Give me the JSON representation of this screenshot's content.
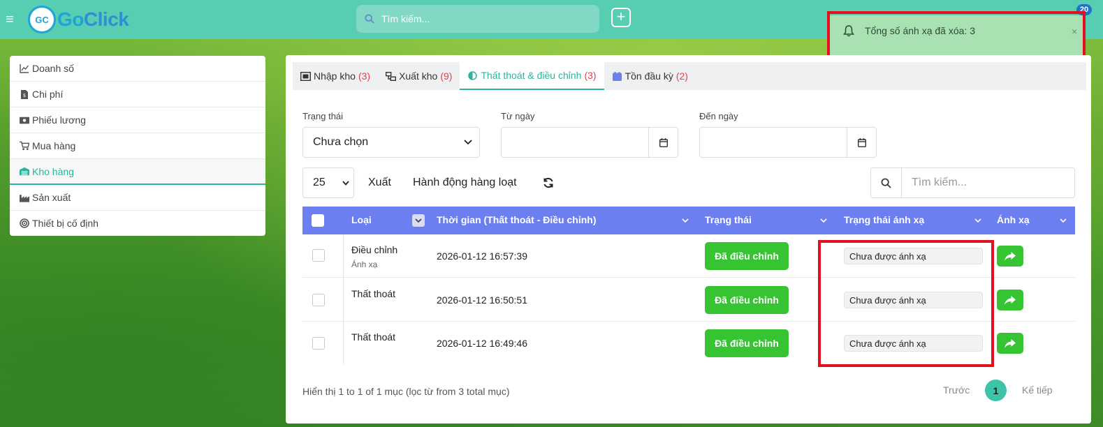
{
  "topbar": {
    "logo_badge": "GC",
    "logo_text_go": "Go",
    "logo_text_click": "Click",
    "search_placeholder": "Tìm kiếm...",
    "notification_count": "20"
  },
  "toast": {
    "message": "Tổng số ánh xạ đã xóa: 3",
    "close": "×"
  },
  "sidebar": {
    "items": [
      {
        "label": "Doanh số",
        "icon": "chart-line-icon"
      },
      {
        "label": "Chi phí",
        "icon": "invoice-icon"
      },
      {
        "label": "Phiếu lương",
        "icon": "money-bill-icon"
      },
      {
        "label": "Mua hàng",
        "icon": "cart-icon"
      },
      {
        "label": "Kho hàng",
        "icon": "warehouse-icon",
        "active": true
      },
      {
        "label": "Sản xuất",
        "icon": "industry-icon"
      },
      {
        "label": "Thiết bị cố định",
        "icon": "target-icon"
      }
    ]
  },
  "tabs": [
    {
      "label": "Nhập kho",
      "count": "(3)"
    },
    {
      "label": "Xuất kho",
      "count": "(9)"
    },
    {
      "label": "Thất thoát & điều chỉnh",
      "count": "(3)",
      "active": true
    },
    {
      "label": "Tồn đầu kỳ",
      "count": "(2)"
    }
  ],
  "filters": {
    "status_label": "Trạng thái",
    "status_value": "Chưa chọn",
    "from_label": "Từ ngày",
    "to_label": "Đến ngày"
  },
  "toolbar": {
    "page_size": "25",
    "export": "Xuất",
    "bulk": "Hành động hàng loạt",
    "search_placeholder": "Tìm kiếm..."
  },
  "table": {
    "headers": {
      "type": "Loại",
      "time": "Thời gian (Thất thoát - Điều chỉnh)",
      "status": "Trạng thái",
      "map_status": "Trạng thái ánh xạ",
      "map": "Ánh xạ"
    },
    "rows": [
      {
        "type": "Điều chỉnh",
        "sub": "Ánh xạ",
        "time": "2026-01-12 16:57:39",
        "status": "Đã điều chỉnh",
        "map_status": "Chưa được ánh xạ"
      },
      {
        "type": "Thất thoát",
        "sub": "",
        "time": "2026-01-12 16:50:51",
        "status": "Đã điều chỉnh",
        "map_status": "Chưa được ánh xạ"
      },
      {
        "type": "Thất thoát",
        "sub": "",
        "time": "2026-01-12 16:49:46",
        "status": "Đã điều chỉnh",
        "map_status": "Chưa được ánh xạ"
      }
    ]
  },
  "footer": {
    "info": "Hiển thị 1 to 1 of 1 mục (lọc từ from 3 total mục)",
    "prev": "Trước",
    "current": "1",
    "next": "Kế tiếp"
  },
  "colors": {
    "topbar": "#57cdb2",
    "accent": "#2cb39a",
    "table_header": "#6b7ff0",
    "success": "#36c432",
    "highlight": "#e5101e"
  }
}
